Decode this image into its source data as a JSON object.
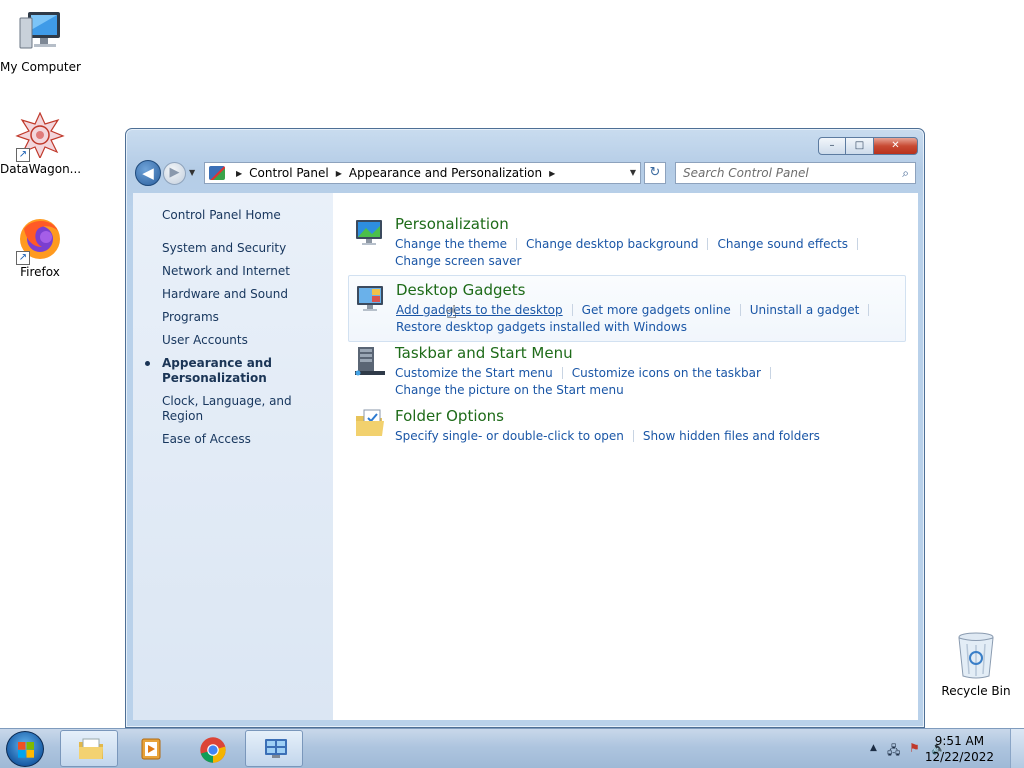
{
  "desktop": {
    "icons": [
      {
        "label": "My Computer"
      },
      {
        "label": "DataWagon..."
      },
      {
        "label": "Firefox"
      },
      {
        "label": "Recycle Bin"
      }
    ]
  },
  "window": {
    "controls": {
      "minimize": "–",
      "maximize": "□",
      "close": "✕"
    },
    "nav": {
      "back": "◀",
      "forward": "▶",
      "breadcrumbs": [
        "Control Panel",
        "Appearance and Personalization"
      ],
      "search_placeholder": "Search Control Panel"
    },
    "sidebar": {
      "home": "Control Panel Home",
      "items": [
        {
          "label": "System and Security"
        },
        {
          "label": "Network and Internet"
        },
        {
          "label": "Hardware and Sound"
        },
        {
          "label": "Programs"
        },
        {
          "label": "User Accounts"
        },
        {
          "label": "Appearance and Personalization",
          "active": true
        },
        {
          "label": "Clock, Language, and Region"
        },
        {
          "label": "Ease of Access"
        }
      ]
    },
    "categories": [
      {
        "title": "Personalization",
        "links": [
          "Change the theme",
          "Change desktop background",
          "Change sound effects",
          "Change screen saver"
        ]
      },
      {
        "title": "Desktop Gadgets",
        "links": [
          "Add gadgets to the desktop",
          "Get more gadgets online",
          "Uninstall a gadget",
          "Restore desktop gadgets installed with Windows"
        ]
      },
      {
        "title": "Taskbar and Start Menu",
        "links": [
          "Customize the Start menu",
          "Customize icons on the taskbar",
          "Change the picture on the Start menu"
        ]
      },
      {
        "title": "Folder Options",
        "links": [
          "Specify single- or double-click to open",
          "Show hidden files and folders"
        ]
      }
    ]
  },
  "taskbar": {
    "apps": [
      "explorer-icon",
      "media-player-icon",
      "chrome-icon",
      "control-panel-icon"
    ],
    "clock": {
      "time": "9:51 AM",
      "date": "12/22/2022"
    }
  },
  "colors": {
    "link": "#1a56a6",
    "category_title": "#1e6b19",
    "sidebar_text": "#17365d"
  }
}
